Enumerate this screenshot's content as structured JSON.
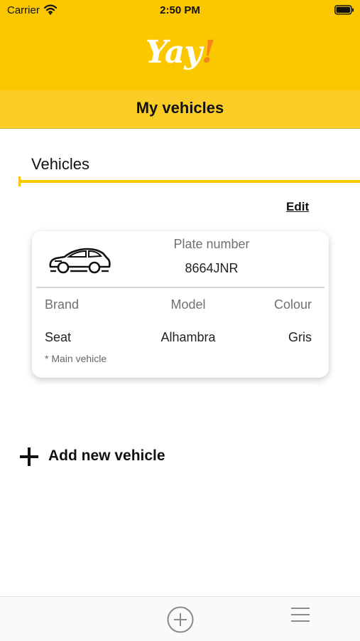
{
  "status_bar": {
    "carrier": "Carrier",
    "time": "2:50 PM",
    "icons": [
      "wifi-icon",
      "battery-icon"
    ]
  },
  "header": {
    "logo_text": "Yay",
    "logo_mark": "!",
    "brand_color": "#fbc800"
  },
  "title_bar": {
    "title": "My vehicles"
  },
  "vehicles_section": {
    "label": "Vehicles",
    "edit_label": "Edit"
  },
  "vehicle_card": {
    "icon": "car-icon",
    "plate_label": "Plate number",
    "plate_value": "8664JNR",
    "columns": [
      {
        "label": "Brand",
        "value": "Seat"
      },
      {
        "label": "Model",
        "value": "Alhambra"
      },
      {
        "label": "Colour",
        "value": "Gris"
      }
    ],
    "note": "* Main vehicle"
  },
  "add_vehicle": {
    "icon": "plus-icon",
    "label": "Add new vehicle"
  },
  "tab_bar": {
    "icons": [
      "add-circle-icon",
      "menu-icon"
    ]
  }
}
